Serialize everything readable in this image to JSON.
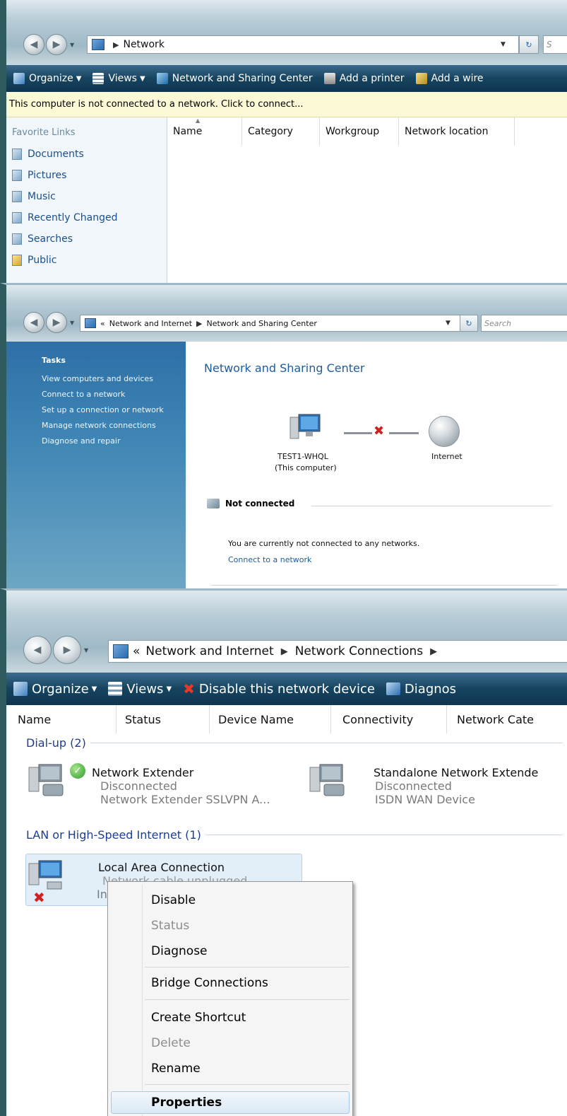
{
  "panel1": {
    "address": {
      "location": "Network"
    },
    "search_placeholder": "S",
    "toolbar": {
      "organize": "Organize",
      "views": "Views",
      "network_sharing_center": "Network and Sharing Center",
      "add_printer": "Add a printer",
      "add_wireless": "Add a wire"
    },
    "info_bar": "This computer is not connected to a network. Click to connect...",
    "favorites": {
      "title": "Favorite Links",
      "items": [
        "Documents",
        "Pictures",
        "Music",
        "Recently Changed",
        "Searches",
        "Public"
      ]
    },
    "columns": [
      "Name",
      "Category",
      "Workgroup",
      "Network location"
    ]
  },
  "panel2": {
    "address": {
      "prefix": "«",
      "crumbs": [
        "Network and Internet",
        "Network and Sharing Center"
      ]
    },
    "search_placeholder": "Search",
    "tasks": {
      "title": "Tasks",
      "items": [
        "View computers and devices",
        "Connect to a network",
        "Set up a connection or network",
        "Manage network connections",
        "Diagnose and repair"
      ]
    },
    "title": "Network and Sharing Center",
    "map": {
      "computer_name": "TEST1-WHQL",
      "computer_note": "(This computer)",
      "internet_label": "Internet"
    },
    "status": {
      "heading": "Not connected",
      "message": "You are currently not connected to any networks.",
      "link": "Connect to a network"
    }
  },
  "panel3": {
    "address": {
      "prefix": "«",
      "crumbs": [
        "Network and Internet",
        "Network Connections"
      ]
    },
    "toolbar": {
      "organize": "Organize",
      "views": "Views",
      "disable": "Disable this network device",
      "diagnose": "Diagnos"
    },
    "columns": [
      "Name",
      "Status",
      "Device Name",
      "Connectivity",
      "Network Cate"
    ],
    "groups": {
      "dialup": {
        "heading": "Dial-up (2)"
      },
      "lan": {
        "heading": "LAN or High-Speed Internet (1)"
      }
    },
    "connections": [
      {
        "name": "Network Extender",
        "status": "Disconnected",
        "device": "Network Extender SSLVPN A..."
      },
      {
        "name": "Standalone Network Extende",
        "status": "Disconnected",
        "device": "ISDN WAN Device"
      },
      {
        "name": "Local Area Connection",
        "status": "Network cable unplugged",
        "device": "In"
      }
    ],
    "context_menu": {
      "items": [
        "Disable",
        "Status",
        "Diagnose",
        "Bridge Connections",
        "Create Shortcut",
        "Delete",
        "Rename",
        "Properties"
      ]
    }
  },
  "colors": {
    "accent": "#1e5c9a",
    "toolbar_dark": "#16445f",
    "info_bar": "#fbf8d5"
  }
}
